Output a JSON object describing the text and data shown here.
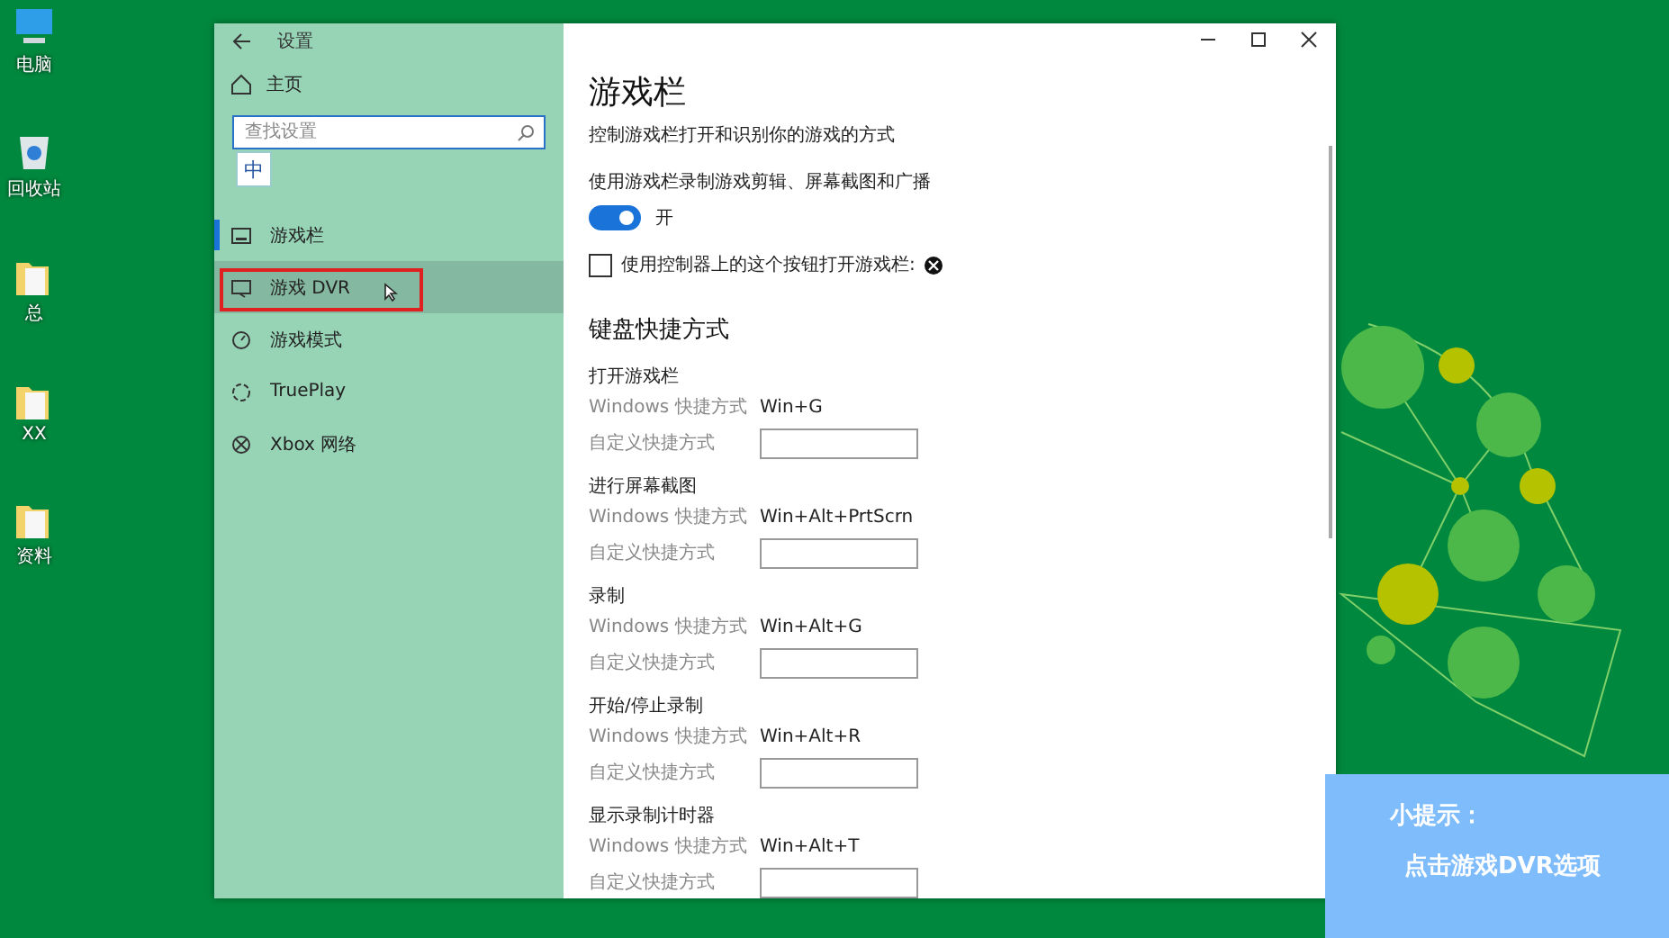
{
  "desktop": {
    "icons": [
      {
        "label": "电脑",
        "kind": "computer"
      },
      {
        "label": "回收站",
        "kind": "bin"
      },
      {
        "label": "总",
        "kind": "folder"
      },
      {
        "label": "XX",
        "kind": "folder"
      },
      {
        "label": "资料",
        "kind": "folder"
      }
    ]
  },
  "window": {
    "title": "设置"
  },
  "sidebar": {
    "home": "主页",
    "search": {
      "placeholder": "查找设置"
    },
    "ime": "中",
    "items": [
      {
        "label": "游戏栏",
        "selected": true,
        "hovered": false,
        "highlighted": false
      },
      {
        "label": "游戏 DVR",
        "selected": false,
        "hovered": true,
        "highlighted": true
      },
      {
        "label": "游戏模式",
        "selected": false,
        "hovered": false,
        "highlighted": false
      },
      {
        "label": "TruePlay",
        "selected": false,
        "hovered": false,
        "highlighted": false
      },
      {
        "label": "Xbox 网络",
        "selected": false,
        "hovered": false,
        "highlighted": false
      }
    ]
  },
  "content": {
    "title": "游戏栏",
    "description": "控制游戏栏打开和识别你的游戏的方式",
    "toggle": {
      "label": "使用游戏栏录制游戏剪辑、屏幕截图和广播",
      "on": true,
      "state_text": "开"
    },
    "checkbox": {
      "label": "使用控制器上的这个按钮打开游戏栏:",
      "checked": false
    },
    "section": "键盘快捷方式",
    "shortcuts": [
      {
        "title": "打开游戏栏",
        "windows_label": "Windows 快捷方式",
        "keys": "Win+G",
        "custom_label": "自定义快捷方式"
      },
      {
        "title": "进行屏幕截图",
        "windows_label": "Windows 快捷方式",
        "keys": "Win+Alt+PrtScrn",
        "custom_label": "自定义快捷方式"
      },
      {
        "title": "录制",
        "windows_label": "Windows 快捷方式",
        "keys": "Win+Alt+G",
        "custom_label": "自定义快捷方式"
      },
      {
        "title": "开始/停止录制",
        "windows_label": "Windows 快捷方式",
        "keys": "Win+Alt+R",
        "custom_label": "自定义快捷方式"
      },
      {
        "title": "显示录制计时器",
        "windows_label": "Windows 快捷方式",
        "keys": "Win+Alt+T",
        "custom_label": "自定义快捷方式"
      }
    ]
  },
  "tip": {
    "title": "小提示：",
    "text": "点击游戏DVR选项"
  }
}
